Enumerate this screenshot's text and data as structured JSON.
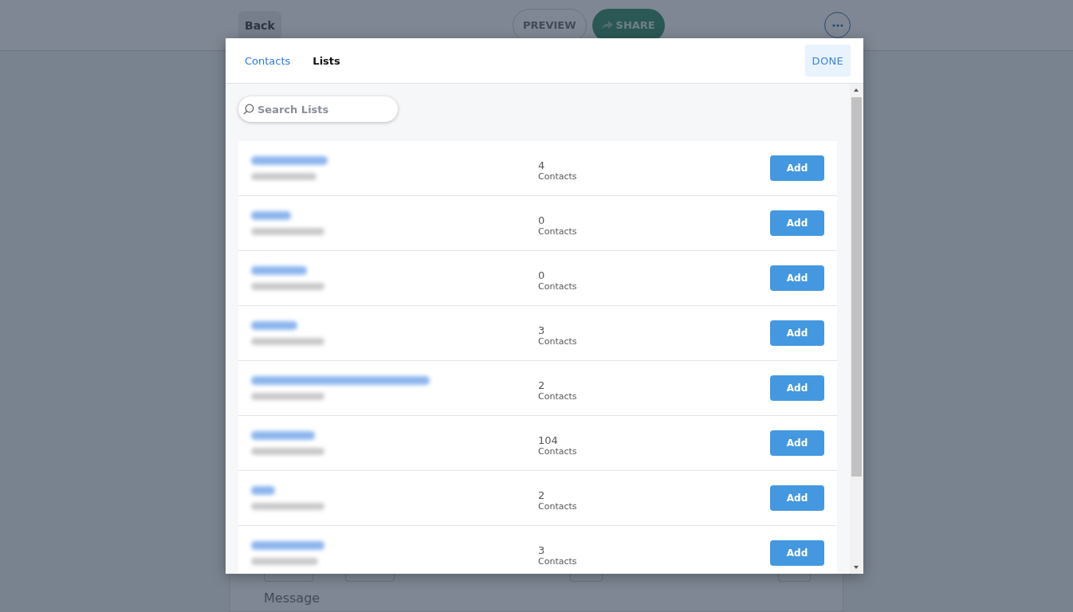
{
  "app_bar": {
    "back": "Back",
    "preview": "PREVIEW",
    "share": "SHARE"
  },
  "editor": {
    "message_placeholder": "Message"
  },
  "dialog": {
    "tabs": [
      {
        "label": "Contacts",
        "selected": false
      },
      {
        "label": "Lists",
        "selected": true
      }
    ],
    "done": "DONE",
    "search": {
      "placeholder": "Search Lists"
    },
    "lists": [
      {
        "count": "4",
        "unit": "Contacts",
        "action": "Add"
      },
      {
        "count": "0",
        "unit": "Contacts",
        "action": "Add"
      },
      {
        "count": "0",
        "unit": "Contacts",
        "action": "Add"
      },
      {
        "count": "3",
        "unit": "Contacts",
        "action": "Add"
      },
      {
        "count": "2",
        "unit": "Contacts",
        "action": "Add"
      },
      {
        "count": "104",
        "unit": "Contacts",
        "action": "Add"
      },
      {
        "count": "2",
        "unit": "Contacts",
        "action": "Add"
      },
      {
        "count": "3",
        "unit": "Contacts",
        "action": "Add"
      }
    ]
  }
}
